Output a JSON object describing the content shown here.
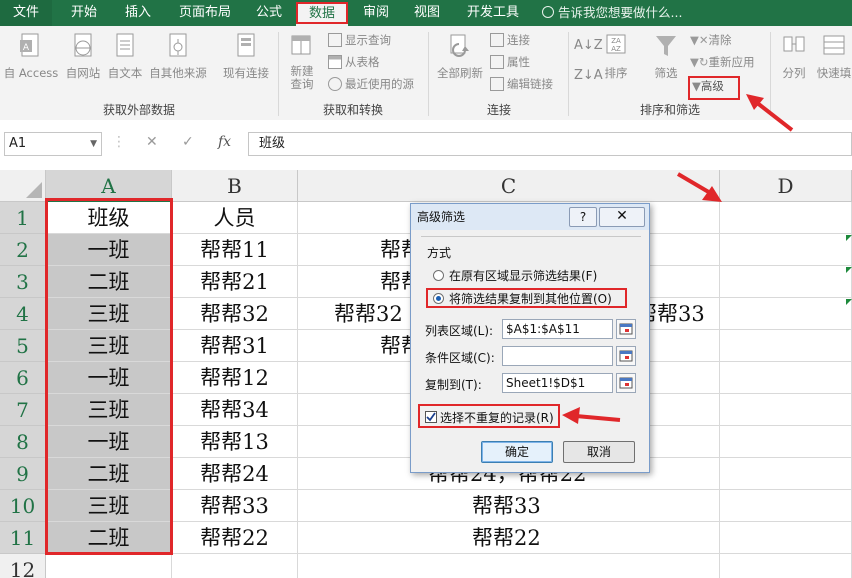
{
  "tabs": [
    {
      "label": "文件",
      "x": 0
    },
    {
      "label": "开始"
    },
    {
      "label": "插入"
    },
    {
      "label": "页面布局"
    },
    {
      "label": "公式"
    },
    {
      "label": "数据"
    },
    {
      "label": "审阅"
    },
    {
      "label": "视图"
    },
    {
      "label": "开发工具"
    }
  ],
  "tell_me": "告诉我您想要做什么...",
  "ribbon": {
    "groups": {
      "external": "获取外部数据",
      "transform": "获取和转换",
      "connections": "连接",
      "sort_filter": "排序和筛选"
    },
    "buttons": {
      "access": "自 Access",
      "web": "自网站",
      "text": "自文本",
      "other": "自其他来源",
      "existing": "现有连接",
      "new_query_1": "新建",
      "new_query_2": "查询",
      "show_queries": "显示查询",
      "from_table": "从表格",
      "recent_sources": "最近使用的源",
      "refresh_all": "全部刷新",
      "connections": "连接",
      "properties": "属性",
      "edit_links": "编辑链接",
      "sort": "排序",
      "filter": "筛选",
      "clear": "清除",
      "reapply": "重新应用",
      "advanced": "高级",
      "split": "分列",
      "flash_fill": "快速填"
    }
  },
  "formula_bar": {
    "name_box": "A1",
    "formula": "班级",
    "fx": "fx"
  },
  "columns": [
    "A",
    "B",
    "C",
    "D"
  ],
  "rows": [
    "1",
    "2",
    "3",
    "4",
    "5",
    "6",
    "7",
    "8",
    "9",
    "10",
    "11",
    "12"
  ],
  "cells": {
    "A": [
      "班级",
      "一班",
      "二班",
      "三班",
      "三班",
      "一班",
      "三班",
      "一班",
      "二班",
      "三班",
      "二班"
    ],
    "B": [
      "人员",
      "帮帮11",
      "帮帮21",
      "帮帮32",
      "帮帮31",
      "帮帮12",
      "帮帮34",
      "帮帮13",
      "帮帮24",
      "帮帮33",
      "帮帮22"
    ],
    "C_visible": {
      "r2": "帮帮",
      "r3": "帮帮",
      "r4_left": "帮帮32",
      "r4_right": "帮帮33",
      "r5": "帮帮",
      "r9": "帮帮24，帮帮22",
      "r10": "帮帮33",
      "r11": "帮帮22"
    }
  },
  "dialog": {
    "title": "高级筛选",
    "help": "?",
    "close": "✕",
    "section": "方式",
    "option1": "在原有区域显示筛选结果(F)",
    "option2": "将筛选结果复制到其他位置(O)",
    "list_range_label": "列表区域(L):",
    "list_range_value": "$A$1:$A$11",
    "criteria_label": "条件区域(C):",
    "criteria_value": "",
    "copy_to_label": "复制到(T):",
    "copy_to_value": "Sheet1!$D$1",
    "unique_label": "选择不重复的记录(R)",
    "unique_checked": true,
    "ok": "确定",
    "cancel": "取消"
  },
  "colors": {
    "excel_green": "#217346",
    "highlight_red": "#e0272a"
  }
}
